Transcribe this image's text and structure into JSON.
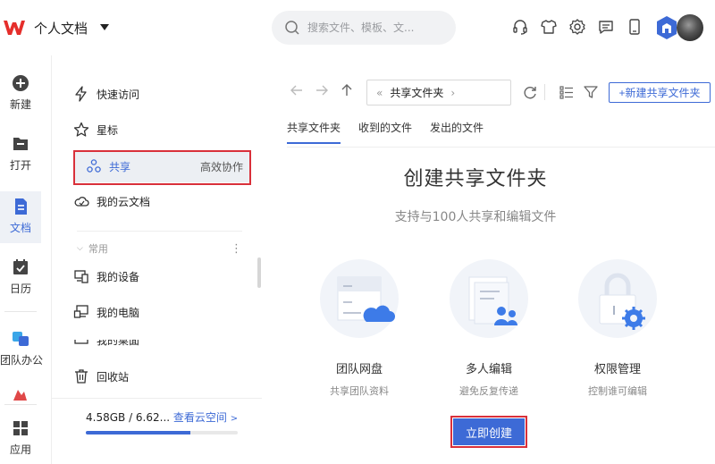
{
  "header": {
    "app_title": "个人文档",
    "search_placeholder": "搜索文件、模板、文..."
  },
  "rail": {
    "items": [
      {
        "label": "新建"
      },
      {
        "label": "打开"
      },
      {
        "label": "文档"
      },
      {
        "label": "日历"
      },
      {
        "label": "团队办公"
      },
      {
        "label": "应用"
      }
    ]
  },
  "nav": {
    "quick_access": "快速访问",
    "starred": "星标",
    "shared": "共享",
    "shared_tag": "高效协作",
    "cloud_docs": "我的云文档",
    "section_common": "常用",
    "section_more": "⋮",
    "my_devices": "我的设备",
    "my_computer": "我的电脑",
    "my_desktop": "我的桌面",
    "recycle_bin": "回收站",
    "storage_text": "4.58GB / 6.62...",
    "storage_link": "查看云空间",
    "storage_link_arrow": ">",
    "storage_fraction": 0.69
  },
  "main": {
    "path_prev": "«",
    "path_label": "共享文件夹",
    "path_next": "›",
    "new_shared_folder": "+新建共享文件夹",
    "tabs": [
      {
        "label": "共享文件夹"
      },
      {
        "label": "收到的文件"
      },
      {
        "label": "发出的文件"
      }
    ],
    "title": "创建共享文件夹",
    "subtitle": "支持与100人共享和编辑文件",
    "features": [
      {
        "title": "团队网盘",
        "desc": "共享团队资料"
      },
      {
        "title": "多人编辑",
        "desc": "避免反复传递"
      },
      {
        "title": "权限管理",
        "desc": "控制谁可编辑"
      }
    ],
    "create_button": "立即创建"
  },
  "colors": {
    "accent": "#3d6ad6",
    "highlight": "#d9303a",
    "logo_red": "#e52e2b"
  }
}
